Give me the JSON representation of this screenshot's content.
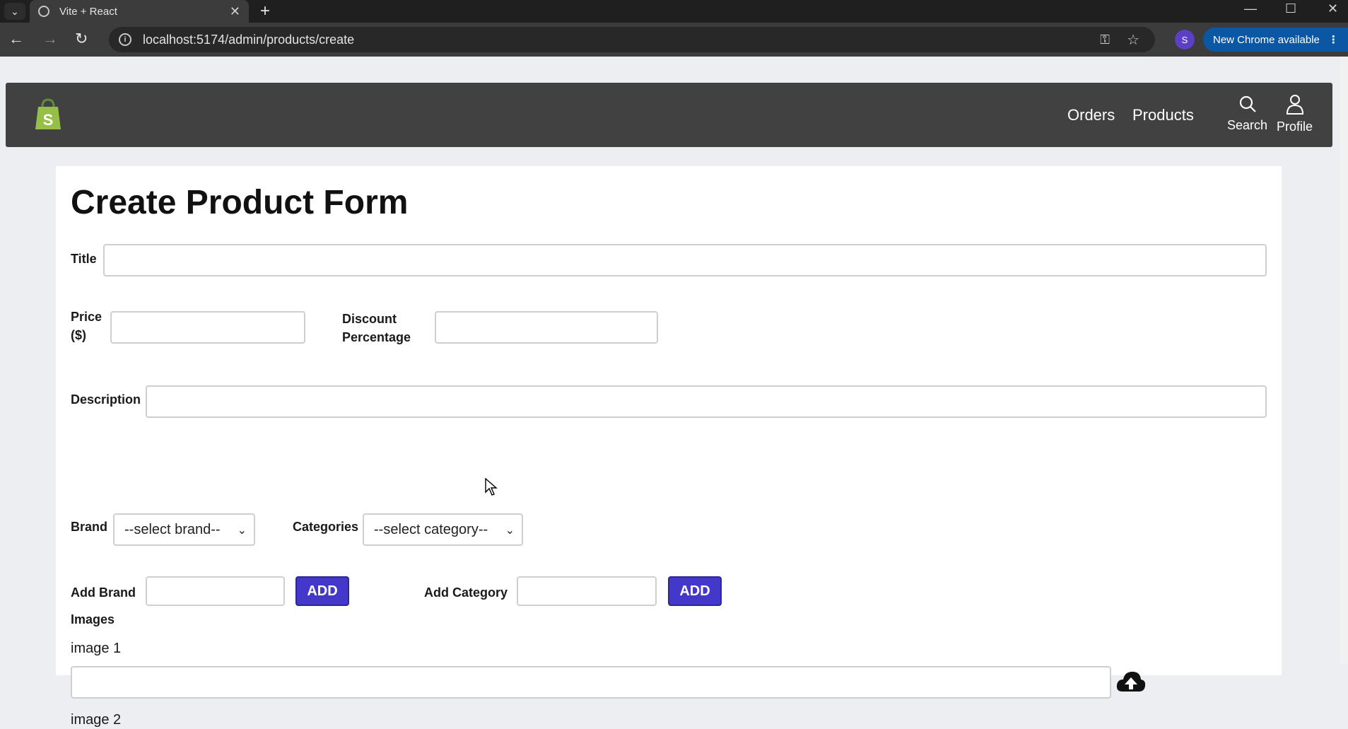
{
  "browser": {
    "tab_title": "Vite + React",
    "url": "localhost:5174/admin/products/create",
    "profile_initial": "S",
    "update_label": "New Chrome available"
  },
  "nav": {
    "orders": "Orders",
    "products": "Products",
    "search": "Search",
    "profile": "Profile"
  },
  "form": {
    "heading": "Create Product Form",
    "title_label": "Title",
    "price_label_1": "Price",
    "price_label_2": "($)",
    "discount_label_1": "Discount",
    "discount_label_2": "Percentage",
    "description_label": "Description",
    "brand_label": "Brand",
    "brand_selected": "--select brand--",
    "categories_label": "Categories",
    "category_selected": "--select category--",
    "add_brand_label": "Add Brand",
    "add_brand_button": "ADD",
    "add_category_label": "Add Category",
    "add_category_button": "ADD",
    "images_label": "Images",
    "image1_label": "image 1",
    "image2_label": "image 2"
  },
  "colors": {
    "accent": "#4338ca",
    "nav_bg": "#414141",
    "shopify_green": "#95bf47"
  }
}
